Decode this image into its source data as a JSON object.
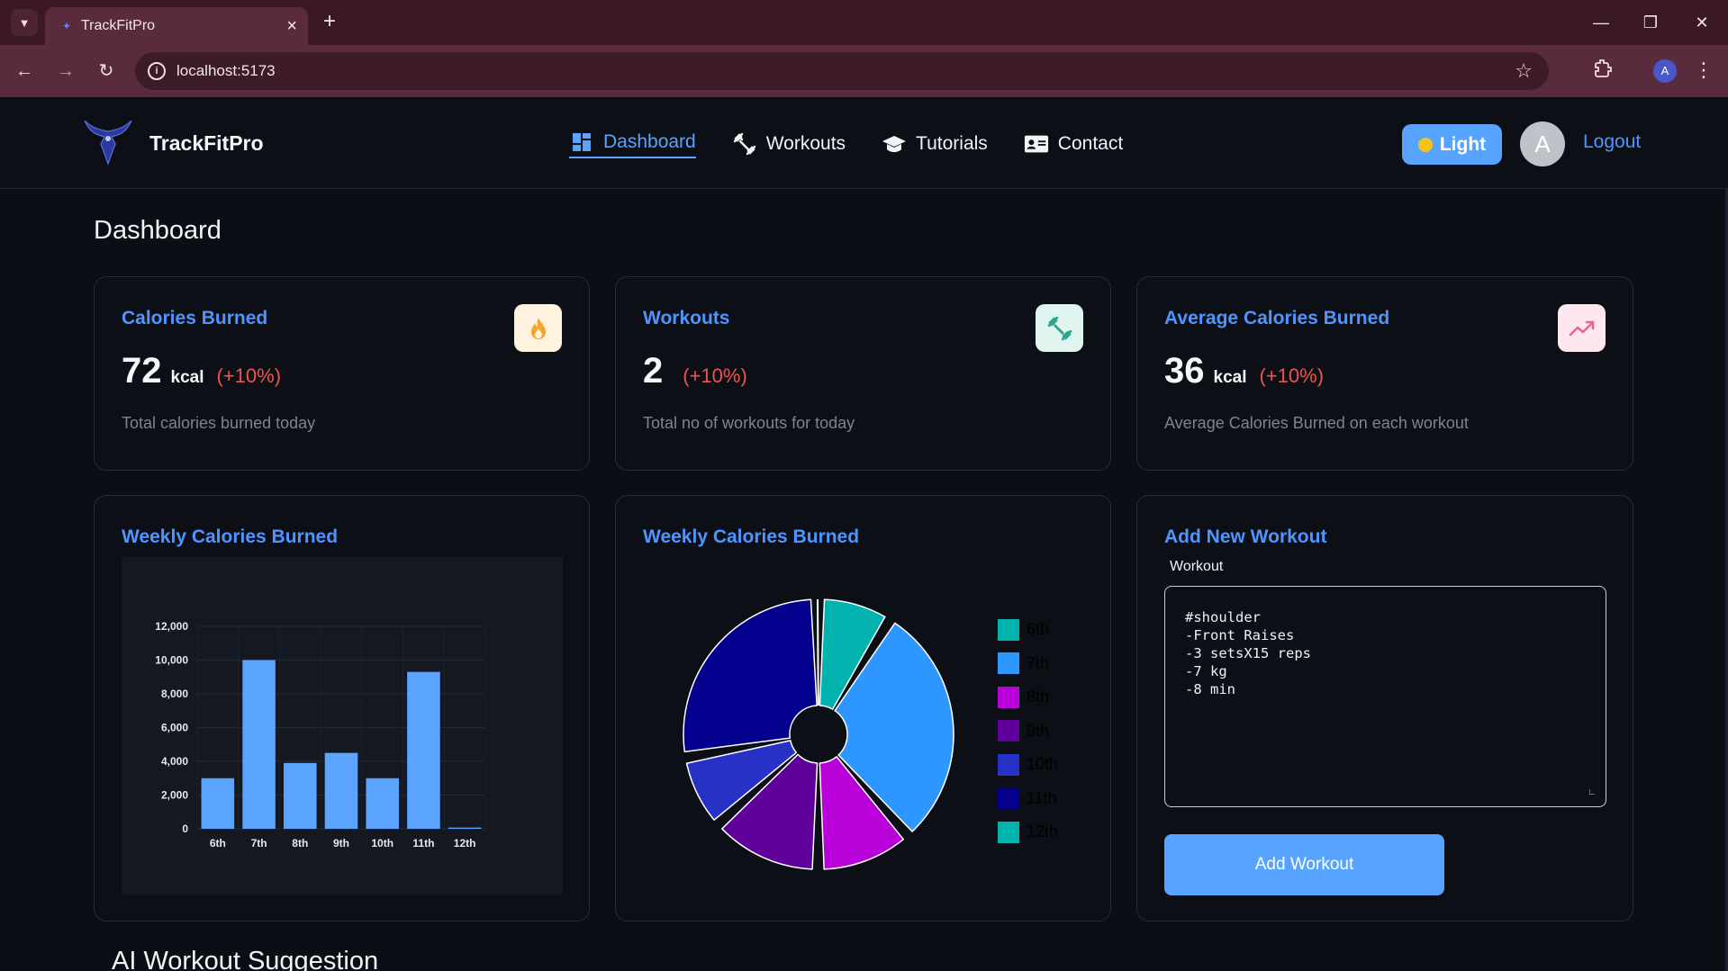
{
  "browser": {
    "tab_title": "TrackFitPro",
    "url": "localhost:5173",
    "profile_initial": "A",
    "colors": {
      "tabbar": "#3a1825",
      "toolbar": "#5a2b3c"
    }
  },
  "header": {
    "brand": "TrackFitPro",
    "nav": [
      {
        "label": "Dashboard",
        "icon": "dashboard-icon",
        "active": true
      },
      {
        "label": "Workouts",
        "icon": "dumbbell-icon",
        "active": false
      },
      {
        "label": "Tutorials",
        "icon": "graduation-cap-icon",
        "active": false
      },
      {
        "label": "Contact",
        "icon": "contact-card-icon",
        "active": false
      }
    ],
    "theme_label": "Light",
    "avatar_initial": "A",
    "logout_label": "Logout",
    "colors": {
      "accent": "#56a4ff",
      "link": "#4f95ff"
    }
  },
  "page": {
    "title": "Dashboard"
  },
  "stats": [
    {
      "title": "Calories Burned",
      "value": "72",
      "unit": "kcal",
      "change": "(+10%)",
      "desc": "Total calories burned today",
      "icon": "flame-icon",
      "icon_bg": "#fff3e0",
      "icon_color": "#f5a623"
    },
    {
      "title": "Workouts",
      "value": "2",
      "unit": "",
      "change": "(+10%)",
      "desc": "Total no of workouts for today",
      "icon": "dumbbell-icon",
      "icon_bg": "#e0f5ef",
      "icon_color": "#2fa58f"
    },
    {
      "title": "Average Calories Burned",
      "value": "36",
      "unit": "kcal",
      "change": "(+10%)",
      "desc": "Average Calories Burned on each workout",
      "icon": "trending-up-icon",
      "icon_bg": "#fde8f0",
      "icon_color": "#f06292"
    }
  ],
  "charts": {
    "bar_title": "Weekly Calories Burned",
    "pie_title": "Weekly Calories Burned"
  },
  "chart_data": [
    {
      "type": "bar",
      "title": "Weekly Calories Burned",
      "categories": [
        "6th",
        "7th",
        "8th",
        "9th",
        "10th",
        "11th",
        "12th"
      ],
      "values": [
        3000,
        10000,
        3900,
        4500,
        3000,
        9300,
        72
      ],
      "yticks": [
        "0",
        "2,000",
        "4,000",
        "6,000",
        "8,000",
        "10,000",
        "12,000"
      ],
      "ylim": [
        0,
        12000
      ],
      "bar_color": "#5aa3ff",
      "grid": true
    },
    {
      "type": "pie",
      "title": "Weekly Calories Burned",
      "categories": [
        "6th",
        "7th",
        "8th",
        "9th",
        "10th",
        "11th",
        "12th"
      ],
      "values": [
        3000,
        10000,
        3900,
        4500,
        3000,
        9300,
        72
      ],
      "colors": [
        "#02b2af",
        "#2e96ff",
        "#b800d8",
        "#60009b",
        "#2731c8",
        "#03008d",
        "#02b2af"
      ],
      "legend_position": "right"
    }
  ],
  "add_workout": {
    "title": "Add New Workout",
    "field_label": "Workout",
    "value": "#shoulder\n-Front Raises\n-3 setsX15 reps\n-7 kg\n-8 min",
    "button_label": "Add Workout"
  },
  "ai_section": {
    "title": "AI Workout Suggestion"
  }
}
